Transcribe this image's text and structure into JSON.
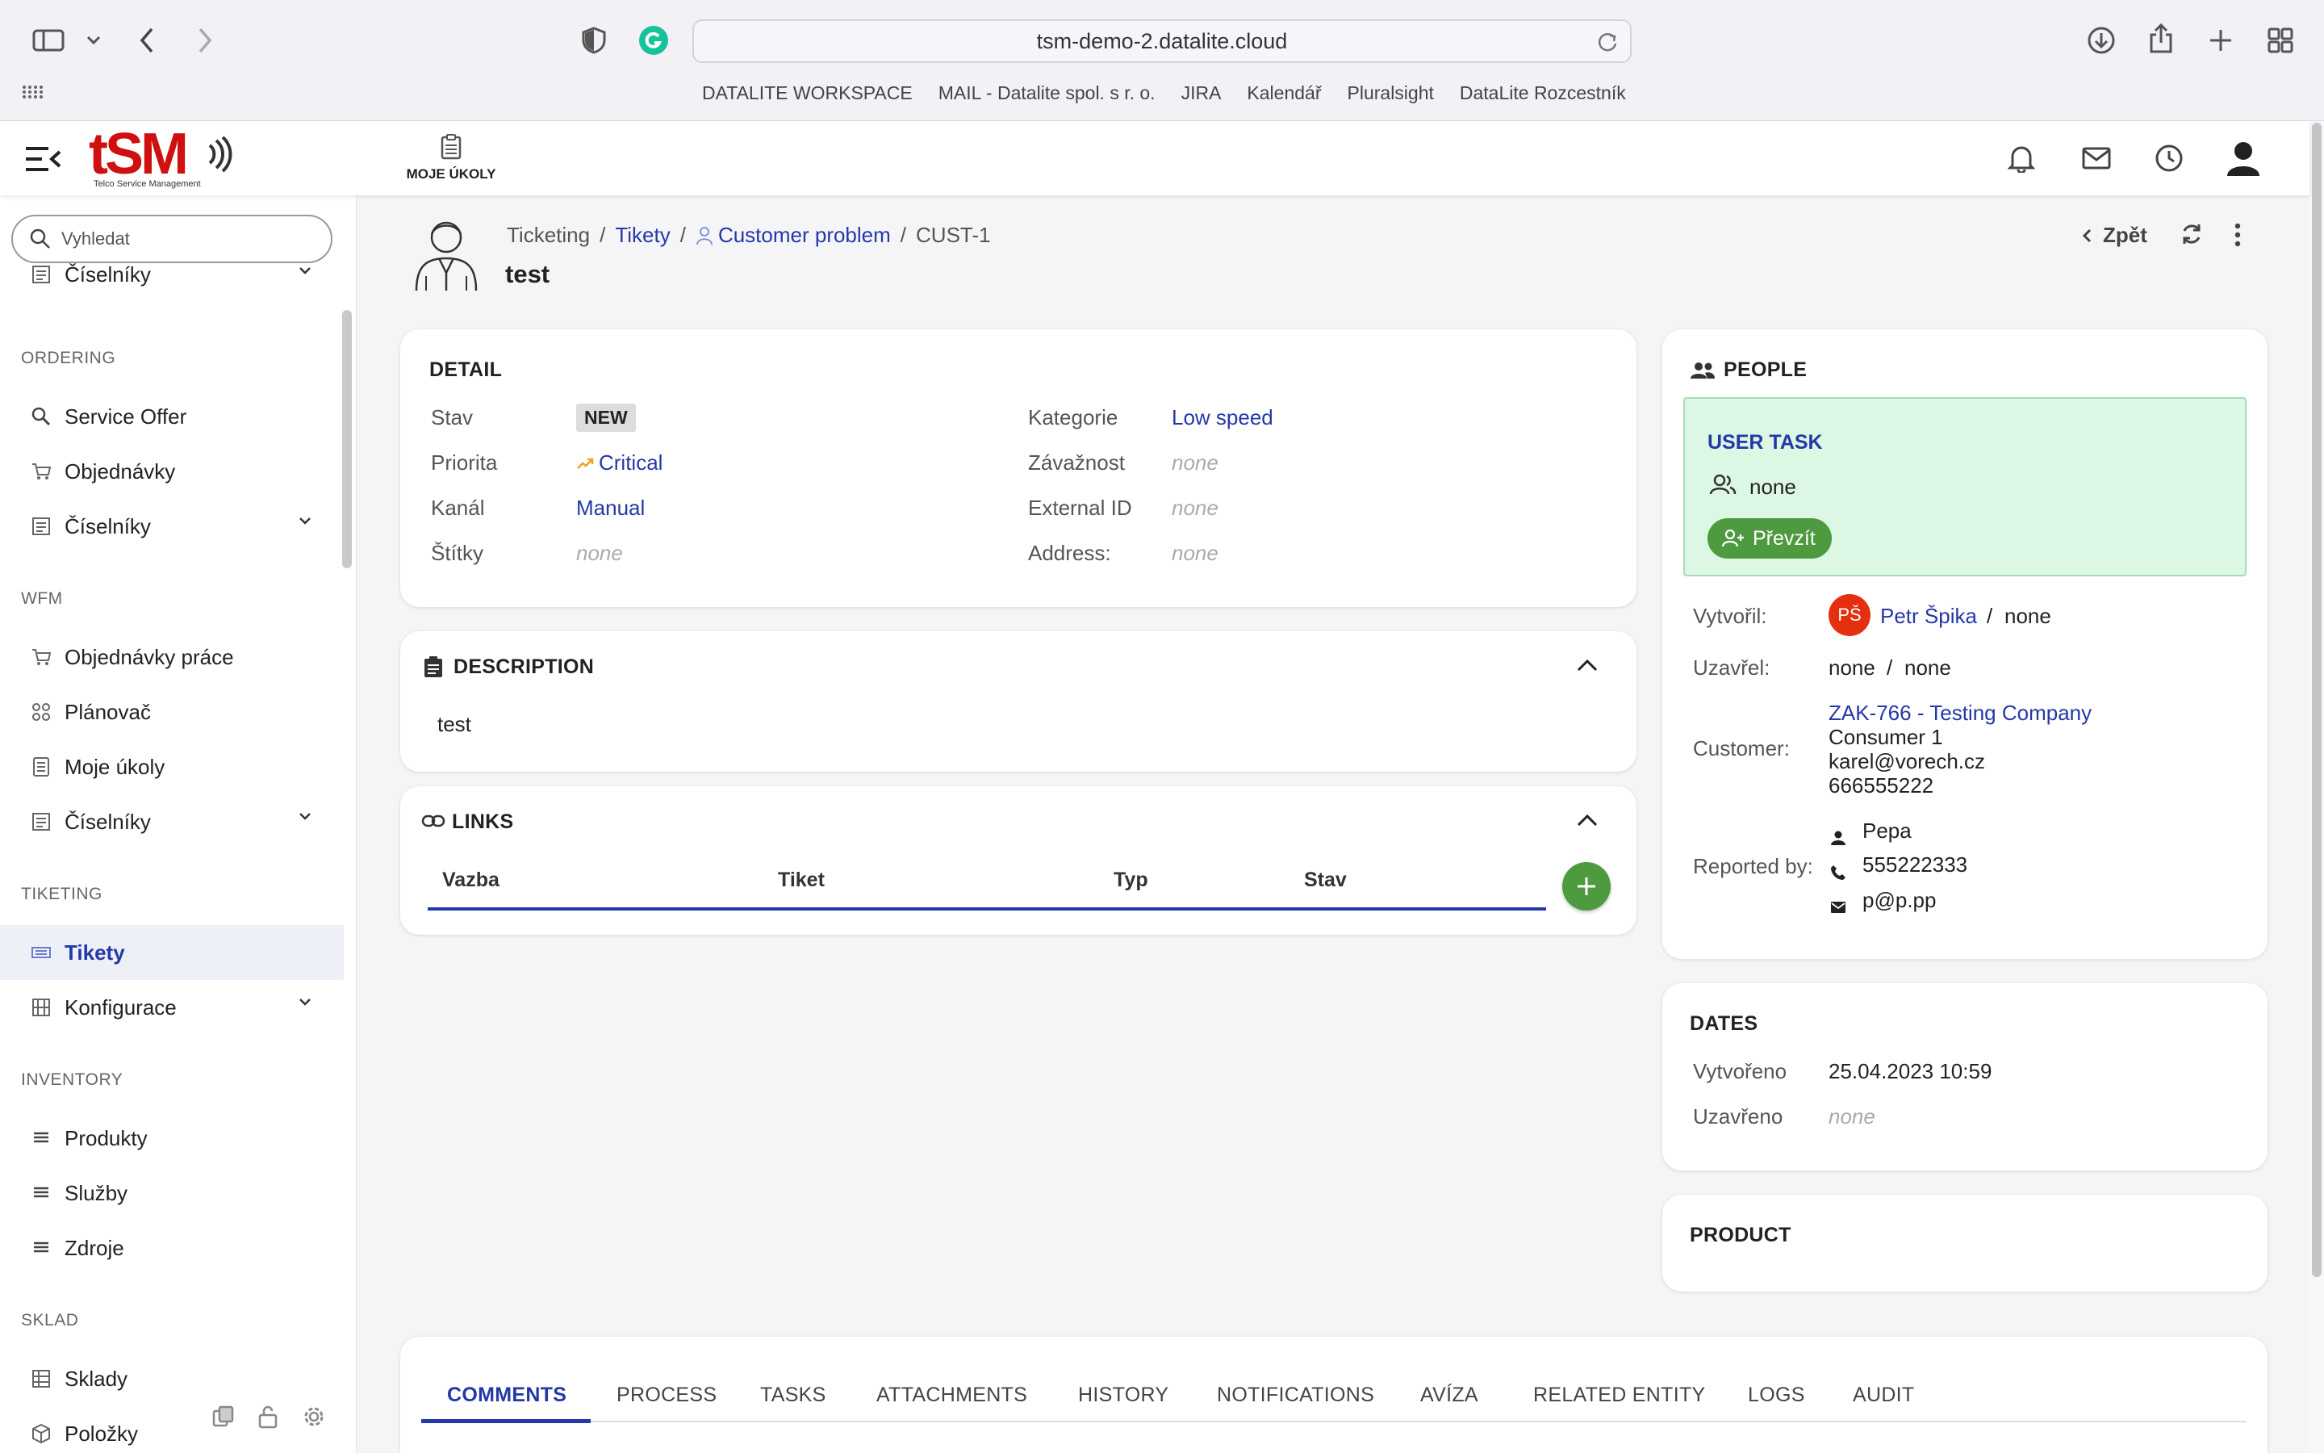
{
  "browser": {
    "url": "tsm-demo-2.datalite.cloud",
    "bookmarks": [
      "DATALITE WORKSPACE",
      "MAIL - Datalite spol. s r. o.",
      "JIRA",
      "Kalendář",
      "Pluralsight",
      "DataLite Rozcestník"
    ]
  },
  "header": {
    "logo_text": "tSM",
    "logo_sub": "Telco Service Management",
    "moje_ukoly": "MOJE ÚKOLY"
  },
  "sidebar": {
    "search_placeholder": "Vyhledat",
    "top_partial": "Číselníky",
    "sections": [
      {
        "title": "ORDERING",
        "items": [
          "Service Offer",
          "Objednávky",
          "Číselníky"
        ]
      },
      {
        "title": "WFM",
        "items": [
          "Objednávky práce",
          "Plánovač",
          "Moje úkoly",
          "Číselníky"
        ]
      },
      {
        "title": "TIKETING",
        "items": [
          "Tikety",
          "Konfigurace"
        ]
      },
      {
        "title": "INVENTORY",
        "items": [
          "Produkty",
          "Služby",
          "Zdroje"
        ]
      },
      {
        "title": "SKLAD",
        "items": [
          "Sklady",
          "Položky"
        ]
      }
    ]
  },
  "breadcrumb": {
    "b1": "Ticketing",
    "b2": "Tikety",
    "b3": "Customer problem",
    "b4": "CUST-1"
  },
  "page_title": "test",
  "actions": {
    "back": "Zpět"
  },
  "detail": {
    "title": "DETAIL",
    "stav_label": "Stav",
    "stav_value": "NEW",
    "priorita_label": "Priorita",
    "priorita_value": "Critical",
    "kanal_label": "Kanál",
    "kanal_value": "Manual",
    "stitky_label": "Štítky",
    "stitky_value": "none",
    "kategorie_label": "Kategorie",
    "kategorie_value": "Low speed",
    "zavaznost_label": "Závažnost",
    "zavaznost_value": "none",
    "external_label": "External ID",
    "external_value": "none",
    "address_label": "Address:",
    "address_value": "none"
  },
  "description": {
    "title": "DESCRIPTION",
    "text": "test"
  },
  "links": {
    "title": "LINKS",
    "columns": [
      "Vazba",
      "Tiket",
      "Typ",
      "Stav"
    ]
  },
  "people": {
    "title": "PEOPLE",
    "user_task": "USER TASK",
    "assignee": "none",
    "take_button": "Převzít",
    "vytvoril_label": "Vytvořil:",
    "avatar": "PŠ",
    "vytvoril_name": "Petr Špika",
    "slash": "/",
    "vytvoril_group": "none",
    "uzavrel_label": "Uzavřel:",
    "uzavrel_name": "none",
    "uzavrel_group": "none",
    "customer_label": "Customer:",
    "customer_link": "ZAK-766 - Testing Company",
    "customer_line1": "Consumer 1",
    "customer_line2": "karel@vorech.cz",
    "customer_line3": "666555222",
    "reported_label": "Reported by:",
    "reported_name": "Pepa",
    "reported_phone": "555222333",
    "reported_email": "p@p.pp"
  },
  "dates": {
    "title": "DATES",
    "vytvoreno_label": "Vytvořeno",
    "vytvoreno_value": "25.04.2023 10:59",
    "uzavreno_label": "Uzavřeno",
    "uzavreno_value": "none"
  },
  "product": {
    "title": "PRODUCT"
  },
  "tabs": [
    "COMMENTS",
    "PROCESS",
    "TASKS",
    "ATTACHMENTS",
    "HISTORY",
    "NOTIFICATIONS",
    "AVÍZA",
    "RELATED ENTITY",
    "LOGS",
    "AUDIT"
  ],
  "colors": {
    "accent": "#2438a8",
    "success": "#4d9a3f",
    "user_task_bg": "#dcf7e3",
    "avatar": "#e53010"
  }
}
